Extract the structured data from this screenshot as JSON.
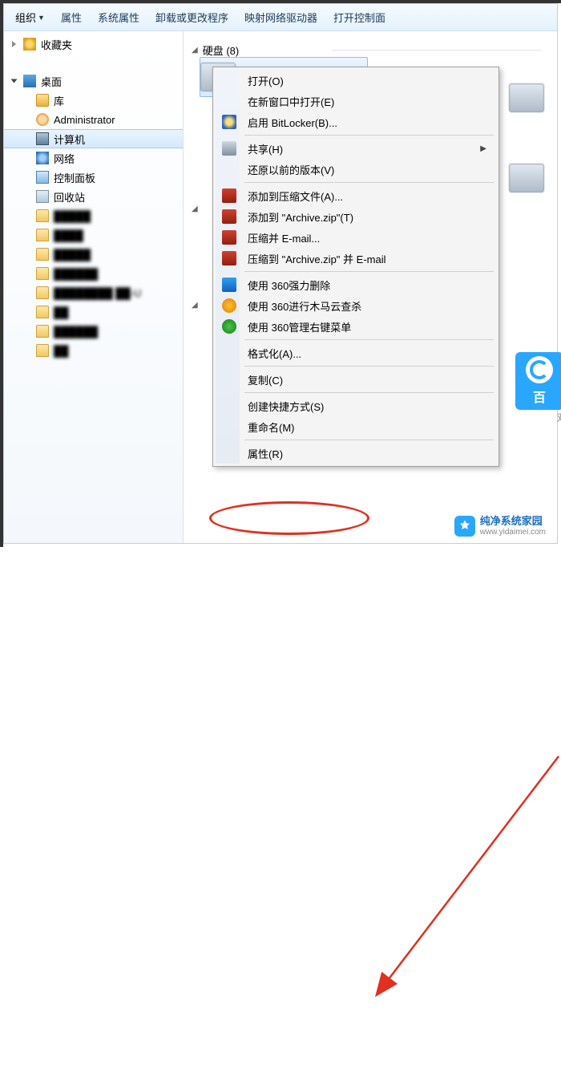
{
  "toolbar": {
    "organize": "组织",
    "properties": "属性",
    "sysprops": "系统属性",
    "uninstall": "卸载或更改程序",
    "mapdrive": "映射网络驱动器",
    "controlpanel": "打开控制面"
  },
  "sidebar": {
    "favorites": "收藏夹",
    "desktop": "桌面",
    "libraries": "库",
    "admin": "Administrator",
    "computer": "计算机",
    "network": "网络",
    "cp": "控制面板",
    "recycle": "回收站",
    "folders": [
      "█████",
      "████",
      "█████",
      "██████",
      "████████ ██-U",
      "██",
      "██████",
      "██"
    ]
  },
  "main": {
    "cat_disk": {
      "prefix": "硬盘",
      "count": "(8)"
    },
    "cat_removable_tri": "◢",
    "cat_other_tri": "◢"
  },
  "baidu": {
    "label": "百",
    "sub": "双"
  },
  "ctx": {
    "open": "打开(O)",
    "newwin": "在新窗口中打开(E)",
    "bitlocker": "启用 BitLocker(B)...",
    "share": "共享(H)",
    "restore": "还原以前的版本(V)",
    "rar_add": "添加到压缩文件(A)...",
    "rar_zip": "添加到 \"Archive.zip\"(T)",
    "rar_mail": "压缩并 E-mail...",
    "rar_zipmail": "压缩到 \"Archive.zip\" 并 E-mail",
    "del360": "使用 360强力删除",
    "scan360": "使用 360进行木马云查杀",
    "menu360": "使用 360管理右键菜单",
    "format": "格式化(A)...",
    "copy": "复制(C)",
    "shortcut": "创建快捷方式(S)",
    "rename": "重命名(M)",
    "props": "属性(R)"
  },
  "watermark": {
    "title": "纯净系统家园",
    "url": "www.yidaimei.com"
  }
}
